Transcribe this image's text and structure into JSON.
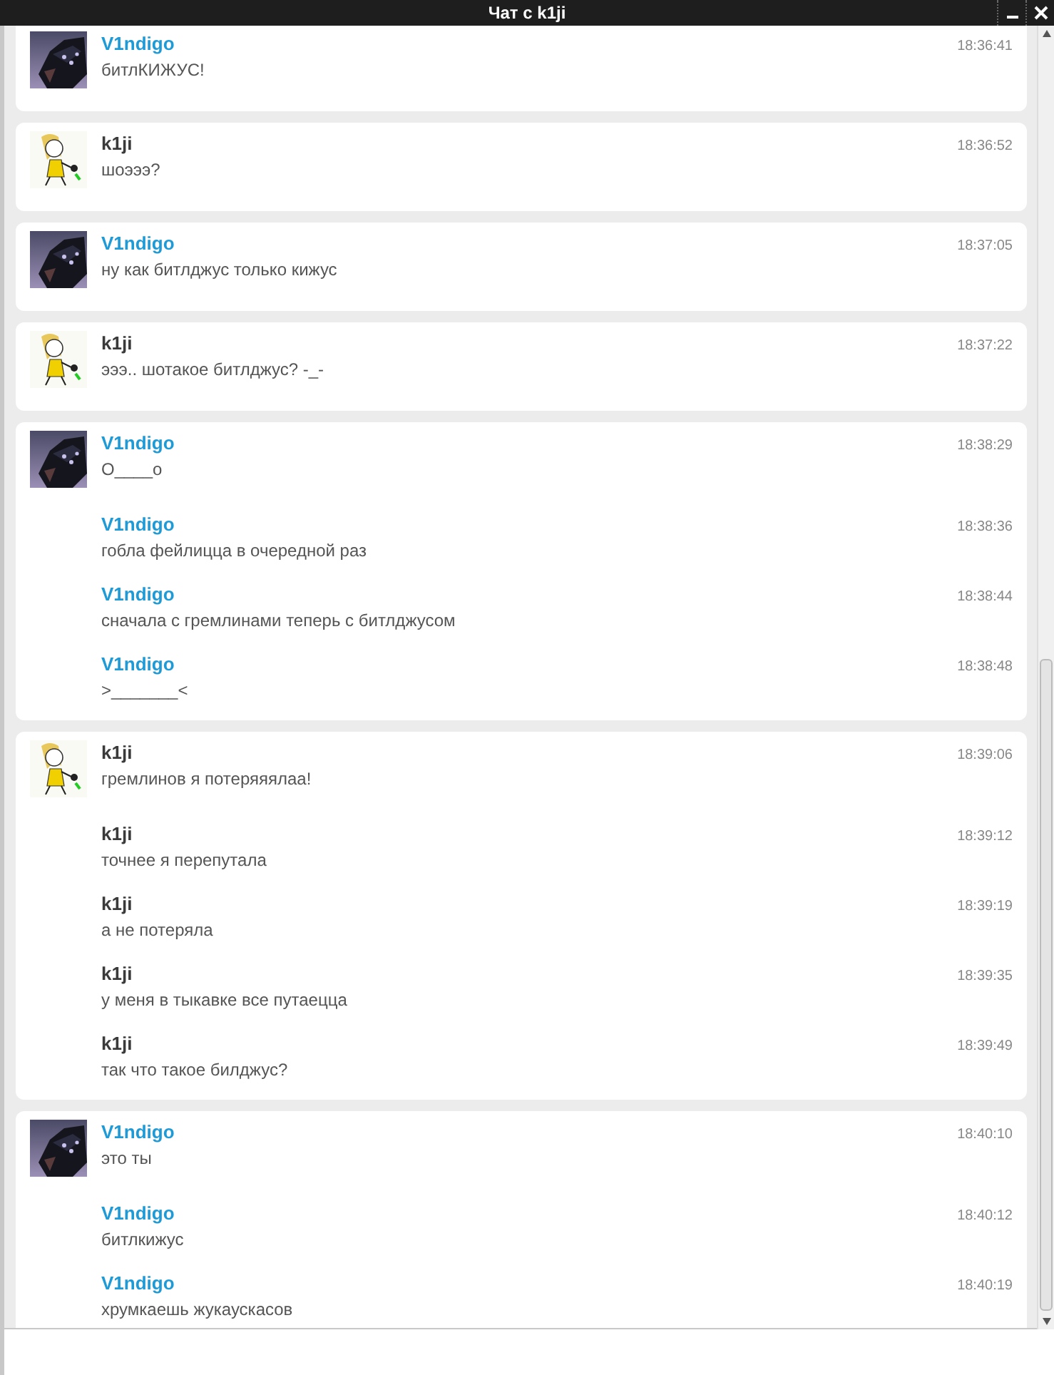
{
  "window": {
    "title": "Чат с k1ji"
  },
  "groups": [
    {
      "color": "#1e9ad6",
      "kind": "dark",
      "messages": [
        {
          "author": "V1ndigo",
          "time": "18:36:41",
          "text": "битлКИЖУС!"
        }
      ]
    },
    {
      "color": "#3a3a3a",
      "kind": "girl",
      "messages": [
        {
          "author": "k1ji",
          "time": "18:36:52",
          "text": "шоэээ?"
        }
      ]
    },
    {
      "color": "#1e9ad6",
      "kind": "dark",
      "messages": [
        {
          "author": "V1ndigo",
          "time": "18:37:05",
          "text": "ну как битлджус только кижус"
        }
      ]
    },
    {
      "color": "#3a3a3a",
      "kind": "girl",
      "messages": [
        {
          "author": "k1ji",
          "time": "18:37:22",
          "text": "эээ.. шотакое битлджус? -_-"
        }
      ]
    },
    {
      "color": "#1e9ad6",
      "kind": "dark",
      "messages": [
        {
          "author": "V1ndigo",
          "time": "18:38:29",
          "text": "О____о"
        },
        {
          "author": "V1ndigo",
          "time": "18:38:36",
          "text": "гобла фейлицца в очередной раз"
        },
        {
          "author": "V1ndigo",
          "time": "18:38:44",
          "text": "сначала с гремлинами теперь с битлджусом"
        },
        {
          "author": "V1ndigo",
          "time": "18:38:48",
          "text": ">_______<"
        }
      ]
    },
    {
      "color": "#3a3a3a",
      "kind": "girl",
      "messages": [
        {
          "author": "k1ji",
          "time": "18:39:06",
          "text": "гремлинов я потеряяялаа!"
        },
        {
          "author": "k1ji",
          "time": "18:39:12",
          "text": "точнее я перепутала"
        },
        {
          "author": "k1ji",
          "time": "18:39:19",
          "text": "а не потеряла"
        },
        {
          "author": "k1ji",
          "time": "18:39:35",
          "text": "у меня в тыкавке все путаецца"
        },
        {
          "author": "k1ji",
          "time": "18:39:49",
          "text": "так что такое билджус?"
        }
      ]
    },
    {
      "color": "#1e9ad6",
      "kind": "dark",
      "messages": [
        {
          "author": "V1ndigo",
          "time": "18:40:10",
          "text": "это ты"
        },
        {
          "author": "V1ndigo",
          "time": "18:40:12",
          "text": "битлкижус"
        },
        {
          "author": "V1ndigo",
          "time": "18:40:19",
          "text": "хрумкаешь жукаускасов"
        }
      ]
    }
  ]
}
